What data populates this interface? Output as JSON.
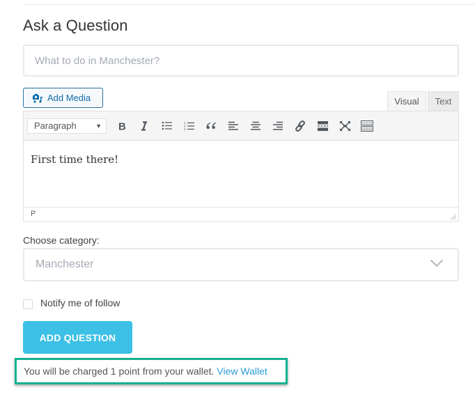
{
  "page": {
    "title": "Ask a Question"
  },
  "question_input": {
    "value": "",
    "placeholder": "What to do in Manchester?"
  },
  "editor": {
    "add_media_label": "Add Media",
    "tabs": [
      {
        "label": "Visual",
        "active": true
      },
      {
        "label": "Text",
        "active": false
      }
    ],
    "format_select": "Paragraph",
    "toolbar_buttons": [
      {
        "name": "bold",
        "icon": "bold-icon"
      },
      {
        "name": "italic",
        "icon": "italic-icon"
      },
      {
        "name": "bulleted-list",
        "icon": "bullet-list-icon"
      },
      {
        "name": "numbered-list",
        "icon": "numbered-list-icon"
      },
      {
        "name": "blockquote",
        "icon": "quote-icon"
      },
      {
        "name": "align-left",
        "icon": "align-left-icon"
      },
      {
        "name": "align-center",
        "icon": "align-center-icon"
      },
      {
        "name": "align-right",
        "icon": "align-right-icon"
      },
      {
        "name": "insert-link",
        "icon": "link-icon"
      },
      {
        "name": "read-more",
        "icon": "read-more-icon"
      },
      {
        "name": "fullscreen",
        "icon": "fullscreen-icon"
      },
      {
        "name": "toolbar-toggle",
        "icon": "keyboard-icon"
      }
    ],
    "content": "First time there!",
    "status_path": "P"
  },
  "category": {
    "label": "Choose category:",
    "selected": "Manchester"
  },
  "notify": {
    "label": "Notify me of follow",
    "checked": false
  },
  "submit": {
    "label": "ADD QUESTION"
  },
  "notice": {
    "text": "You will be charged 1 point from your wallet.",
    "link_label": "View Wallet"
  },
  "colors": {
    "accent_button": "#3cc0e6",
    "highlight_border": "#16b191",
    "link": "#2d9bd3",
    "add_media_text": "#0e6ba8"
  }
}
